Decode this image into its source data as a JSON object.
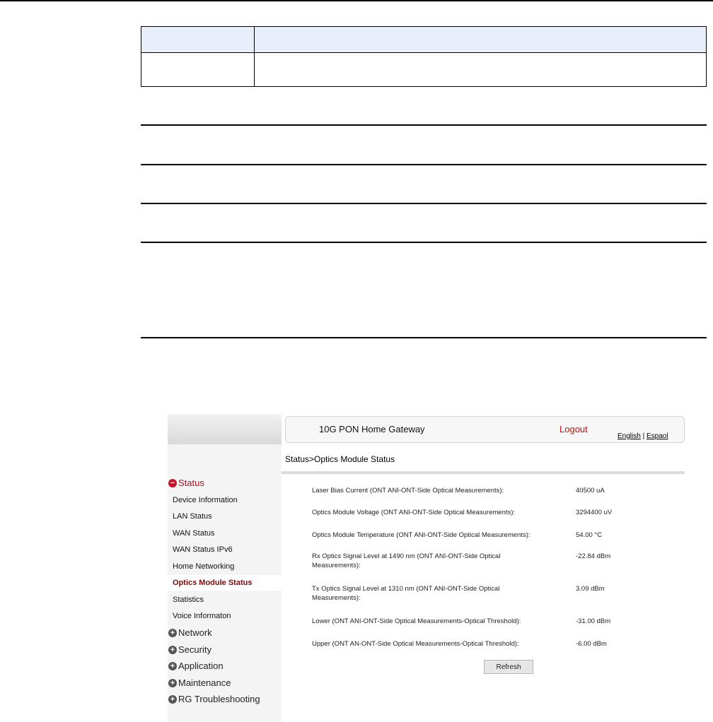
{
  "gateway": {
    "title": "10G PON Home Gateway",
    "logout": "Logout",
    "lang_english": "English",
    "lang_sep": " | ",
    "lang_espanol": "Espaol"
  },
  "breadcrumb": "Status>Optics Module Status",
  "nav": {
    "status_section": "Status",
    "status_items": [
      "Device Information",
      "LAN Status",
      "WAN Status",
      "WAN Status IPv6",
      "Home Networking",
      "Optics Module Status",
      "Statistics",
      "Voice Informaton"
    ],
    "sections": [
      "Network",
      "Security",
      "Application",
      "Maintenance",
      "RG Troubleshooting"
    ],
    "active": "Optics Module Status"
  },
  "measurements": [
    {
      "label": "Laser Bias Current (ONT ANI-ONT-Side Optical Measurements):",
      "value": "40500 uA"
    },
    {
      "label": "Optics Module Voltage (ONT ANI-ONT-Side Optical Measurements):",
      "value": "3294400 uV"
    },
    {
      "label": "Optics Module Temperature (ONT ANI-ONT-Side Optical Measurements):",
      "value": "54.00 °C"
    },
    {
      "label": "Rx Optics Signal Level at 1490 nm (ONT ANI-ONT-Side Optical Measurements):",
      "value": "-22.84 dBm"
    },
    {
      "label": "Tx Optics Signal Level at 1310 nm (ONT ANI-ONT-Side Optical Measurements):",
      "value": "3.09 dBm"
    },
    {
      "label": "Lower (ONT ANI-ONT-Side Optical Measurements-Optical Threshold):",
      "value": "-31.00 dBm"
    },
    {
      "label": "Upper (ONT AN-ONT-Side Optical Measurements-Optical Threshold):",
      "value": "-6.00 dBm"
    }
  ],
  "refresh_label": "Refresh",
  "icons": {
    "expanded": "minus-circle-icon",
    "collapsed": "plus-circle-icon"
  },
  "colors": {
    "accent": "#c01010",
    "active_item": "#7a0b0b"
  }
}
